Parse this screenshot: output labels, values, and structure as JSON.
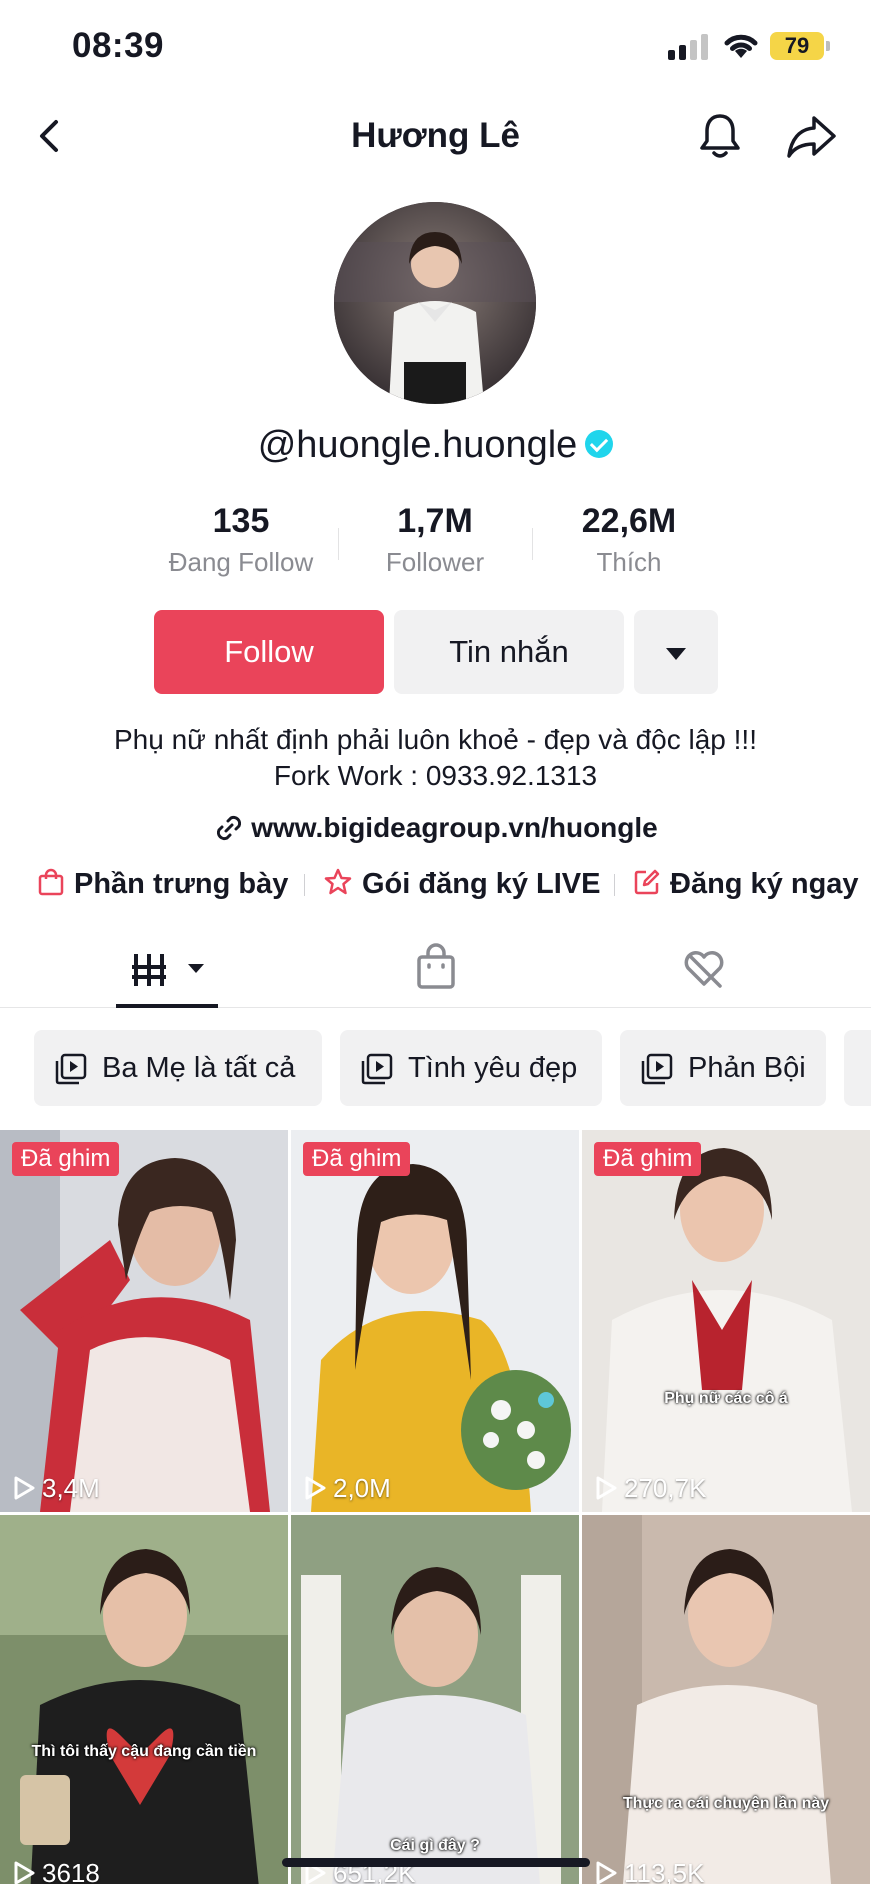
{
  "status_bar": {
    "time": "08:39",
    "battery": "79"
  },
  "nav": {
    "title": "Hương Lê",
    "icons": [
      "back-icon",
      "bell-icon",
      "share-icon"
    ]
  },
  "profile": {
    "username": "@huongle.huongle",
    "verified": true,
    "stats": [
      {
        "value": "135",
        "label": "Đang Follow"
      },
      {
        "value": "1,7M",
        "label": "Follower"
      },
      {
        "value": "22,6M",
        "label": "Thích"
      }
    ],
    "buttons": {
      "follow": "Follow",
      "message": "Tin nhắn"
    },
    "bio": [
      "Phụ nữ nhất định phải luôn khoẻ - đẹp và độc lập !!!",
      "Fork Work : 0933.92.1313"
    ],
    "link": "www.bigideagroup.vn/huongle",
    "chips": [
      {
        "label": "Phần trưng bày",
        "icon": "shopping-bag-icon"
      },
      {
        "label": "Gói đăng ký LIVE",
        "icon": "star-badge-icon"
      },
      {
        "label": "Đăng ký ngay",
        "icon": "edit-icon"
      }
    ]
  },
  "tabs": [
    {
      "name": "videos",
      "icon": "grid-icon",
      "active": true
    },
    {
      "name": "shop",
      "icon": "shopping-bag-icon"
    },
    {
      "name": "liked",
      "icon": "hidden-heart-icon"
    }
  ],
  "playlists": [
    {
      "label": "Ba Mẹ là tất cả"
    },
    {
      "label": "Tình yêu đẹp"
    },
    {
      "label": "Phản Bội"
    }
  ],
  "videos": [
    {
      "pinned_label": "Đã ghim",
      "views": "3,4M",
      "caption": ""
    },
    {
      "pinned_label": "Đã ghim",
      "views": "2,0M",
      "caption": ""
    },
    {
      "pinned_label": "Đã ghim",
      "views": "270,7K",
      "caption": "Phụ nữ các cô á"
    },
    {
      "pinned_label": "",
      "views": "3618",
      "caption": "Thì tôi thấy cậu đang cần tiền"
    },
    {
      "pinned_label": "",
      "views": "651,2K",
      "caption": "Cái gì đây ?"
    },
    {
      "pinned_label": "",
      "views": "113,5K",
      "caption": "Thực ra cái chuyện lần này"
    }
  ],
  "colors": {
    "accent": "#ea445a",
    "verified": "#20d5ec",
    "battery": "#f5d547"
  }
}
